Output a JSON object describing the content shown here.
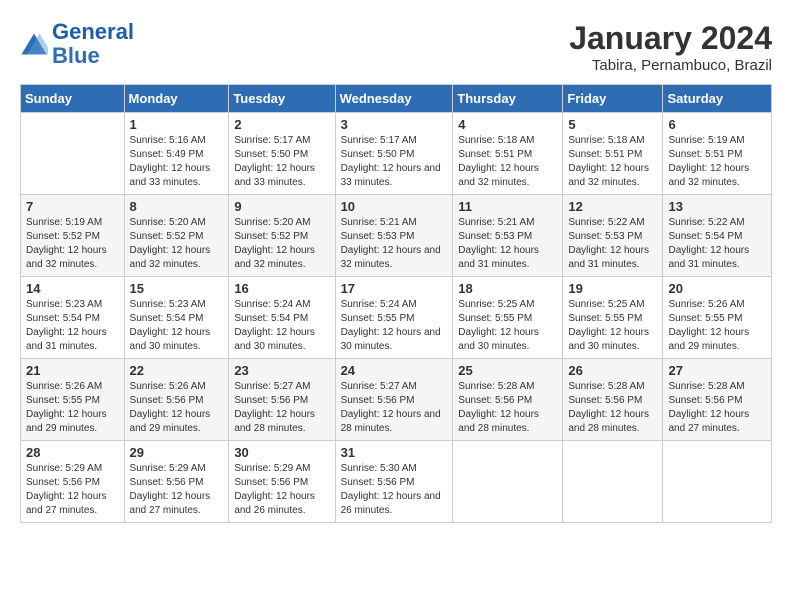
{
  "logo": {
    "line1": "General",
    "line2": "Blue"
  },
  "title": "January 2024",
  "location": "Tabira, Pernambuco, Brazil",
  "days_of_week": [
    "Sunday",
    "Monday",
    "Tuesday",
    "Wednesday",
    "Thursday",
    "Friday",
    "Saturday"
  ],
  "weeks": [
    [
      {
        "num": "",
        "sunrise": "",
        "sunset": "",
        "daylight": ""
      },
      {
        "num": "1",
        "sunrise": "Sunrise: 5:16 AM",
        "sunset": "Sunset: 5:49 PM",
        "daylight": "Daylight: 12 hours and 33 minutes."
      },
      {
        "num": "2",
        "sunrise": "Sunrise: 5:17 AM",
        "sunset": "Sunset: 5:50 PM",
        "daylight": "Daylight: 12 hours and 33 minutes."
      },
      {
        "num": "3",
        "sunrise": "Sunrise: 5:17 AM",
        "sunset": "Sunset: 5:50 PM",
        "daylight": "Daylight: 12 hours and 33 minutes."
      },
      {
        "num": "4",
        "sunrise": "Sunrise: 5:18 AM",
        "sunset": "Sunset: 5:51 PM",
        "daylight": "Daylight: 12 hours and 32 minutes."
      },
      {
        "num": "5",
        "sunrise": "Sunrise: 5:18 AM",
        "sunset": "Sunset: 5:51 PM",
        "daylight": "Daylight: 12 hours and 32 minutes."
      },
      {
        "num": "6",
        "sunrise": "Sunrise: 5:19 AM",
        "sunset": "Sunset: 5:51 PM",
        "daylight": "Daylight: 12 hours and 32 minutes."
      }
    ],
    [
      {
        "num": "7",
        "sunrise": "Sunrise: 5:19 AM",
        "sunset": "Sunset: 5:52 PM",
        "daylight": "Daylight: 12 hours and 32 minutes."
      },
      {
        "num": "8",
        "sunrise": "Sunrise: 5:20 AM",
        "sunset": "Sunset: 5:52 PM",
        "daylight": "Daylight: 12 hours and 32 minutes."
      },
      {
        "num": "9",
        "sunrise": "Sunrise: 5:20 AM",
        "sunset": "Sunset: 5:52 PM",
        "daylight": "Daylight: 12 hours and 32 minutes."
      },
      {
        "num": "10",
        "sunrise": "Sunrise: 5:21 AM",
        "sunset": "Sunset: 5:53 PM",
        "daylight": "Daylight: 12 hours and 32 minutes."
      },
      {
        "num": "11",
        "sunrise": "Sunrise: 5:21 AM",
        "sunset": "Sunset: 5:53 PM",
        "daylight": "Daylight: 12 hours and 31 minutes."
      },
      {
        "num": "12",
        "sunrise": "Sunrise: 5:22 AM",
        "sunset": "Sunset: 5:53 PM",
        "daylight": "Daylight: 12 hours and 31 minutes."
      },
      {
        "num": "13",
        "sunrise": "Sunrise: 5:22 AM",
        "sunset": "Sunset: 5:54 PM",
        "daylight": "Daylight: 12 hours and 31 minutes."
      }
    ],
    [
      {
        "num": "14",
        "sunrise": "Sunrise: 5:23 AM",
        "sunset": "Sunset: 5:54 PM",
        "daylight": "Daylight: 12 hours and 31 minutes."
      },
      {
        "num": "15",
        "sunrise": "Sunrise: 5:23 AM",
        "sunset": "Sunset: 5:54 PM",
        "daylight": "Daylight: 12 hours and 30 minutes."
      },
      {
        "num": "16",
        "sunrise": "Sunrise: 5:24 AM",
        "sunset": "Sunset: 5:54 PM",
        "daylight": "Daylight: 12 hours and 30 minutes."
      },
      {
        "num": "17",
        "sunrise": "Sunrise: 5:24 AM",
        "sunset": "Sunset: 5:55 PM",
        "daylight": "Daylight: 12 hours and 30 minutes."
      },
      {
        "num": "18",
        "sunrise": "Sunrise: 5:25 AM",
        "sunset": "Sunset: 5:55 PM",
        "daylight": "Daylight: 12 hours and 30 minutes."
      },
      {
        "num": "19",
        "sunrise": "Sunrise: 5:25 AM",
        "sunset": "Sunset: 5:55 PM",
        "daylight": "Daylight: 12 hours and 30 minutes."
      },
      {
        "num": "20",
        "sunrise": "Sunrise: 5:26 AM",
        "sunset": "Sunset: 5:55 PM",
        "daylight": "Daylight: 12 hours and 29 minutes."
      }
    ],
    [
      {
        "num": "21",
        "sunrise": "Sunrise: 5:26 AM",
        "sunset": "Sunset: 5:55 PM",
        "daylight": "Daylight: 12 hours and 29 minutes."
      },
      {
        "num": "22",
        "sunrise": "Sunrise: 5:26 AM",
        "sunset": "Sunset: 5:56 PM",
        "daylight": "Daylight: 12 hours and 29 minutes."
      },
      {
        "num": "23",
        "sunrise": "Sunrise: 5:27 AM",
        "sunset": "Sunset: 5:56 PM",
        "daylight": "Daylight: 12 hours and 28 minutes."
      },
      {
        "num": "24",
        "sunrise": "Sunrise: 5:27 AM",
        "sunset": "Sunset: 5:56 PM",
        "daylight": "Daylight: 12 hours and 28 minutes."
      },
      {
        "num": "25",
        "sunrise": "Sunrise: 5:28 AM",
        "sunset": "Sunset: 5:56 PM",
        "daylight": "Daylight: 12 hours and 28 minutes."
      },
      {
        "num": "26",
        "sunrise": "Sunrise: 5:28 AM",
        "sunset": "Sunset: 5:56 PM",
        "daylight": "Daylight: 12 hours and 28 minutes."
      },
      {
        "num": "27",
        "sunrise": "Sunrise: 5:28 AM",
        "sunset": "Sunset: 5:56 PM",
        "daylight": "Daylight: 12 hours and 27 minutes."
      }
    ],
    [
      {
        "num": "28",
        "sunrise": "Sunrise: 5:29 AM",
        "sunset": "Sunset: 5:56 PM",
        "daylight": "Daylight: 12 hours and 27 minutes."
      },
      {
        "num": "29",
        "sunrise": "Sunrise: 5:29 AM",
        "sunset": "Sunset: 5:56 PM",
        "daylight": "Daylight: 12 hours and 27 minutes."
      },
      {
        "num": "30",
        "sunrise": "Sunrise: 5:29 AM",
        "sunset": "Sunset: 5:56 PM",
        "daylight": "Daylight: 12 hours and 26 minutes."
      },
      {
        "num": "31",
        "sunrise": "Sunrise: 5:30 AM",
        "sunset": "Sunset: 5:56 PM",
        "daylight": "Daylight: 12 hours and 26 minutes."
      },
      {
        "num": "",
        "sunrise": "",
        "sunset": "",
        "daylight": ""
      },
      {
        "num": "",
        "sunrise": "",
        "sunset": "",
        "daylight": ""
      },
      {
        "num": "",
        "sunrise": "",
        "sunset": "",
        "daylight": ""
      }
    ]
  ]
}
